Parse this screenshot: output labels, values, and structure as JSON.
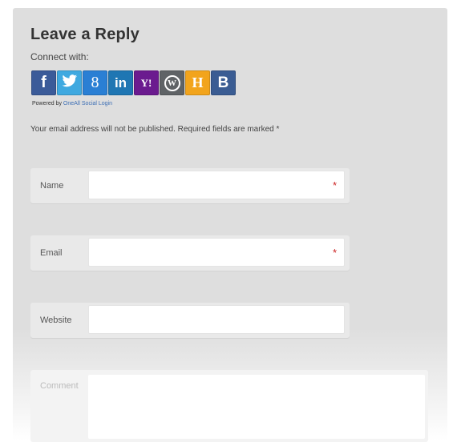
{
  "reply": {
    "title": "Leave a Reply",
    "connect_label": "Connect with:",
    "social": [
      {
        "name": "facebook",
        "glyph": "f",
        "color": "#3b5b99",
        "text_color": "#ffffff"
      },
      {
        "name": "twitter",
        "glyph": "🐦",
        "color": "#3fa9e0",
        "text_color": "#ffffff"
      },
      {
        "name": "google",
        "glyph": "8",
        "color": "#2a7fd4",
        "text_color": "#ffffff"
      },
      {
        "name": "linkedin",
        "glyph": "in",
        "color": "#1f76b3",
        "text_color": "#ffffff"
      },
      {
        "name": "yahoo",
        "glyph": "Y!",
        "color": "#6b1b8f",
        "text_color": "#ffffff"
      },
      {
        "name": "wordpress",
        "glyph": "W",
        "color": "#5f6366",
        "text_color": "#ffffff"
      },
      {
        "name": "hyves",
        "glyph": "H",
        "color": "#f2a41c",
        "text_color": "#ffffff"
      },
      {
        "name": "blogger",
        "glyph": "B",
        "color": "#3a5c93",
        "text_color": "#ffffff"
      }
    ],
    "powered_by_prefix": "Powered by ",
    "powered_by_link": "OneAll Social Login",
    "notes": "Your email address will not be published. Required fields are marked *",
    "fields": {
      "name": {
        "label": "Name",
        "value": "",
        "required_mark": "*"
      },
      "email": {
        "label": "Email",
        "value": "",
        "required_mark": "*"
      },
      "website": {
        "label": "Website",
        "value": ""
      },
      "comment": {
        "label": "Comment",
        "value": ""
      }
    }
  }
}
